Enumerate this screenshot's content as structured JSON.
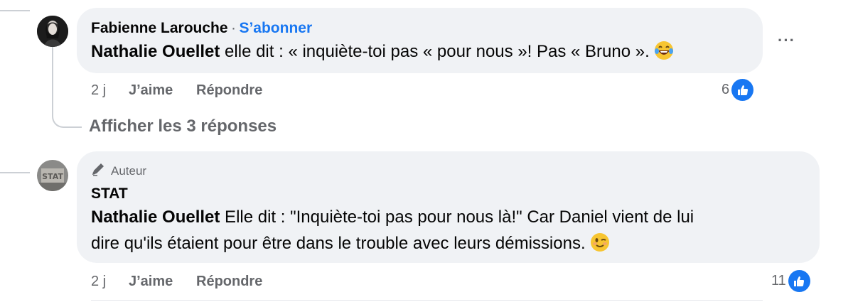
{
  "comment1": {
    "author": "Fabienne Larouche",
    "separator": "·",
    "follow_label": "S’abonner",
    "mention": "Nathalie Ouellet",
    "text": " elle dit : « inquiète-toi pas « pour nous »! Pas « Bruno ». ",
    "emoji": "laughing-tears-emoji",
    "time": "2 j",
    "like_label": "J’aime",
    "reply_label": "Répondre",
    "reaction_count": "6",
    "more_label": "···"
  },
  "view_replies_label": "Afficher les 3 réponses",
  "comment2": {
    "badge_label": "Auteur",
    "author": "STAT",
    "mention": "Nathalie Ouellet",
    "text_line1": " Elle dit : \"Inquiète-toi pas pour nous là!\" Car Daniel vient de lui",
    "text_line2": "dire qu'ils étaient pour être dans le trouble avec leurs démissions. ",
    "emoji": "winking-emoji",
    "time": "2 j",
    "like_label": "J’aime",
    "reply_label": "Répondre",
    "reaction_count": "11"
  },
  "colors": {
    "bubble": "#f0f2f5",
    "link_blue": "#1877f2",
    "secondary_text": "#65676b"
  }
}
